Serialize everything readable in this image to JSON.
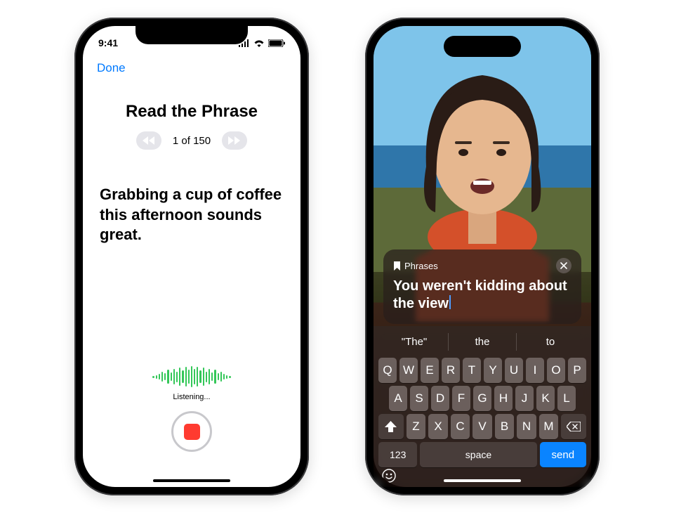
{
  "left_phone": {
    "status": {
      "time": "9:41"
    },
    "done_label": "Done",
    "title": "Read the Phrase",
    "pager_text": "1 of 150",
    "phrase_text": "Grabbing a cup of coffee this afternoon sounds great.",
    "listening_label": "Listening..."
  },
  "right_phone": {
    "phrases_card": {
      "chip_label": "Phrases",
      "typed_text": "You weren't kidding about the view"
    },
    "keyboard": {
      "suggestions": [
        "\"The\"",
        "the",
        "to"
      ],
      "row1": [
        "Q",
        "W",
        "E",
        "R",
        "T",
        "Y",
        "U",
        "I",
        "O",
        "P"
      ],
      "row2": [
        "A",
        "S",
        "D",
        "F",
        "G",
        "H",
        "J",
        "K",
        "L"
      ],
      "row3": [
        "Z",
        "X",
        "C",
        "V",
        "B",
        "N",
        "M"
      ],
      "num_label": "123",
      "space_label": "space",
      "send_label": "send"
    }
  }
}
